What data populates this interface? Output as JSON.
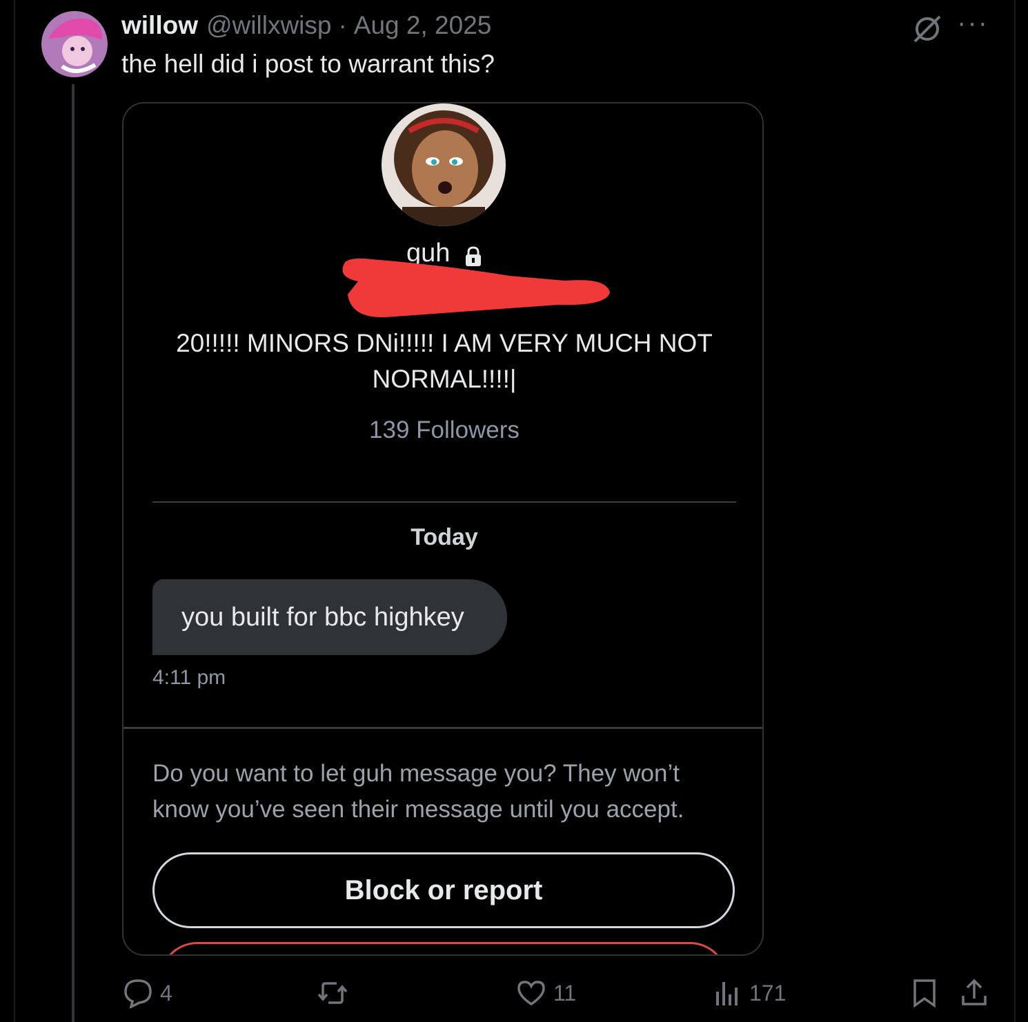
{
  "tweet": {
    "display_name": "willow",
    "handle": "@willxwisp",
    "separator": "·",
    "date": "Aug 2, 2025",
    "text": "the hell did i post to warrant this?",
    "more_label": "···"
  },
  "screenshot": {
    "profile_name": "guh",
    "bio": "20!!!!! MINORS DNi!!!!! I AM VERY MUCH NOT NORMAL!!!!|",
    "followers": "139 Followers",
    "day_label": "Today",
    "message": "you built for bbc highkey",
    "message_time": "4:11 pm",
    "request_text": "Do you want to let guh message you? They won’t know you’ve seen their message until you accept.",
    "block_button": "Block or report"
  },
  "actions": {
    "replies": "4",
    "likes": "11",
    "views": "171"
  },
  "icons": [
    "grok-icon",
    "more-icon",
    "lock-icon",
    "reply-icon",
    "retweet-icon",
    "like-icon",
    "views-icon",
    "bookmark-icon",
    "share-icon"
  ],
  "colors": {
    "background": "#000000",
    "text": "#e7e9ea",
    "muted": "#71767b",
    "redaction": "#f03a3a"
  }
}
